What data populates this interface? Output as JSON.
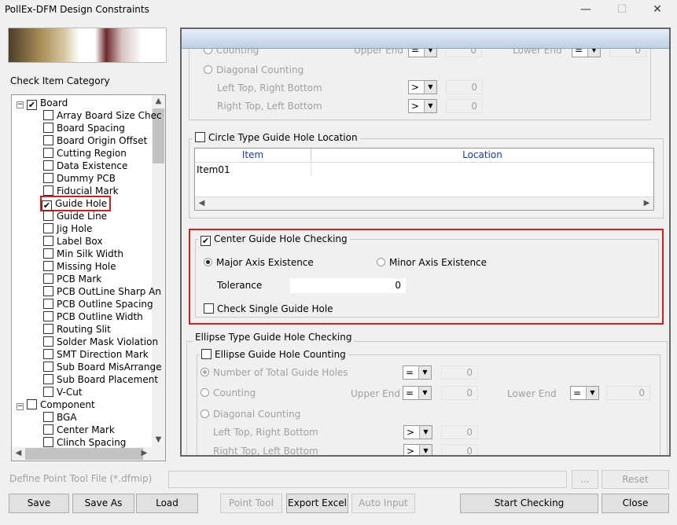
{
  "window": {
    "title": "PollEx-DFM Design Constraints",
    "minimize": "—",
    "maximize": "☐",
    "close": "✕"
  },
  "sidebar": {
    "label": "Check Item Category",
    "root_board": {
      "label": "Board",
      "checked": true
    },
    "board_items": [
      {
        "label": "Array Board Size Chec",
        "checked": false
      },
      {
        "label": "Board Spacing",
        "checked": false
      },
      {
        "label": "Board Origin Offset",
        "checked": false
      },
      {
        "label": "Cutting Region",
        "checked": false
      },
      {
        "label": "Data Existence",
        "checked": false
      },
      {
        "label": "Dummy PCB",
        "checked": false
      },
      {
        "label": "Fiducial Mark",
        "checked": false
      },
      {
        "label": "Guide Hole",
        "checked": true
      },
      {
        "label": "Guide Line",
        "checked": false
      },
      {
        "label": "Jig Hole",
        "checked": false
      },
      {
        "label": "Label Box",
        "checked": false
      },
      {
        "label": "Min Silk Width",
        "checked": false
      },
      {
        "label": "Missing Hole",
        "checked": false
      },
      {
        "label": "PCB Mark",
        "checked": false
      },
      {
        "label": "PCB OutLine Sharp An",
        "checked": false
      },
      {
        "label": "PCB Outline Spacing",
        "checked": false
      },
      {
        "label": "PCB Outline Width",
        "checked": false
      },
      {
        "label": "Routing Slit",
        "checked": false
      },
      {
        "label": "Solder Mask Violation",
        "checked": false
      },
      {
        "label": "SMT Direction Mark",
        "checked": false
      },
      {
        "label": "Sub Board MisArrange",
        "checked": false
      },
      {
        "label": "Sub Board Placement",
        "checked": false
      },
      {
        "label": "V-Cut",
        "checked": false
      }
    ],
    "root_component": {
      "label": "Component",
      "checked": false
    },
    "component_items": [
      {
        "label": "BGA",
        "checked": false
      },
      {
        "label": "Center Mark",
        "checked": false
      },
      {
        "label": "Clinch Spacing",
        "checked": false
      }
    ]
  },
  "circle_counting": {
    "counting_label": "Counting",
    "upper_end": "Upper End",
    "upper_op": "=",
    "upper_val": "0",
    "lower_end": "Lower End",
    "lower_op": "=",
    "lower_val": "0",
    "diagonal_label": "Diagonal Counting",
    "ltrb_label": "Left Top, Right Bottom",
    "ltrb_op": ">",
    "ltrb_val": "0",
    "rtlb_label": "Right Top, Left Bottom",
    "rtlb_op": ">",
    "rtlb_val": "0"
  },
  "circle_location": {
    "label": "Circle Type Guide Hole Location",
    "checked": false,
    "columns": [
      "Item",
      "Location"
    ],
    "rows": [
      [
        "Item01",
        ""
      ]
    ]
  },
  "center_check": {
    "label": "Center Guide Hole Checking",
    "checked": true,
    "major": "Major Axis Existence",
    "minor": "Minor Axis Existence",
    "selected": "major",
    "tolerance_label": "Tolerance",
    "tolerance": "0",
    "single_label": "Check Single Guide Hole",
    "single_checked": false
  },
  "ellipse": {
    "group_label": "Ellipse Type Guide Hole Checking",
    "counting_label": "Ellipse Guide Hole Counting",
    "counting_checked": false,
    "total_label": "Number of Total Guide Holes",
    "total_op": "=",
    "total_val": "0",
    "counting": "Counting",
    "upper_end": "Upper End",
    "upper_op": "=",
    "upper_val": "0",
    "lower_end": "Lower End",
    "lower_op": "=",
    "lower_val": "0",
    "diagonal_label": "Diagonal Counting",
    "ltrb_label": "Left Top, Right Bottom",
    "ltrb_op": ">",
    "ltrb_val": "0",
    "rtlb_label": "Right Top, Left Bottom",
    "rtlb_op": ">",
    "rtlb_val": "0"
  },
  "footer": {
    "file_label": "Define Point Tool File (*.dfmip)",
    "file_value": "",
    "browse": "...",
    "reset": "Reset",
    "save": "Save",
    "save_as": "Save As",
    "load": "Load",
    "point_tool": "Point Tool",
    "export_excel": "Export Excel",
    "auto_input": "Auto Input",
    "start_checking": "Start Checking",
    "close": "Close"
  },
  "colors": {
    "highlight": "#cc1f1f",
    "header_gradient": "#bcd0e6"
  }
}
